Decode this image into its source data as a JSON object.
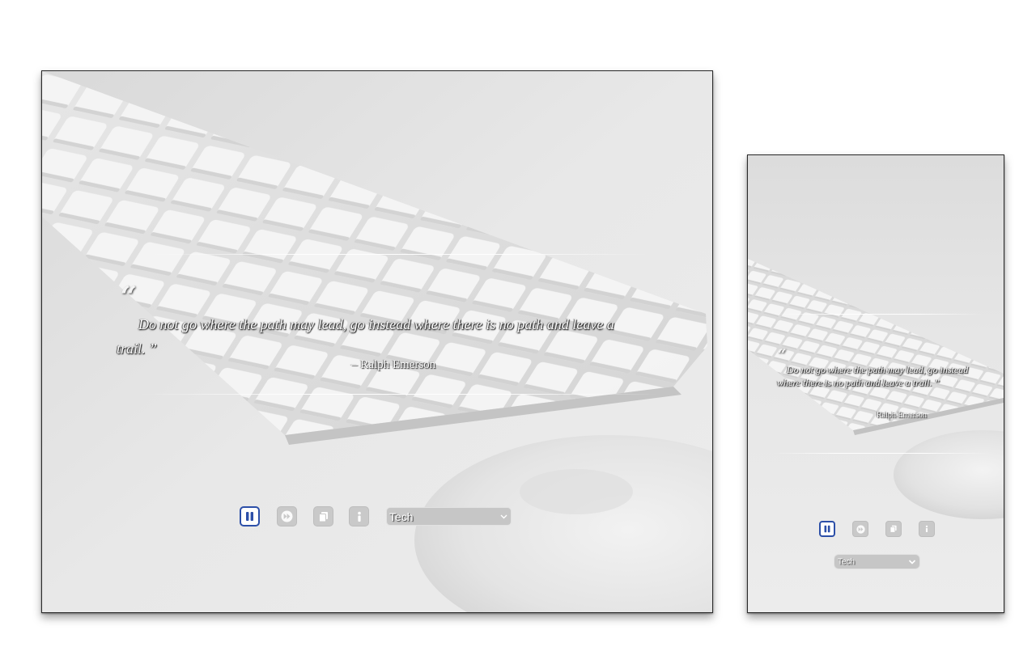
{
  "theme": {
    "accent": "#2c4fa8",
    "muted_button": "#c9c9c9",
    "background": "#e6e6e6"
  },
  "quote": {
    "open_mark": "“",
    "text": "Do not go where the path may lead, go instead where there is no path and leave a trail. ”",
    "author": "– Ralph Emerson"
  },
  "mobile_quote": {
    "open_mark": "“",
    "text": "Do not go where the path may lead, go instead where there is no path and leave a trail. ”",
    "author": "Ralph Emerson"
  },
  "controls": {
    "pause_icon": "pause-icon",
    "next_icon": "fast-forward-icon",
    "copy_icon": "copy-icon",
    "info_icon": "info-icon"
  },
  "category_select": {
    "selected": "Tech",
    "chevron_icon": "chevron-down-icon"
  }
}
